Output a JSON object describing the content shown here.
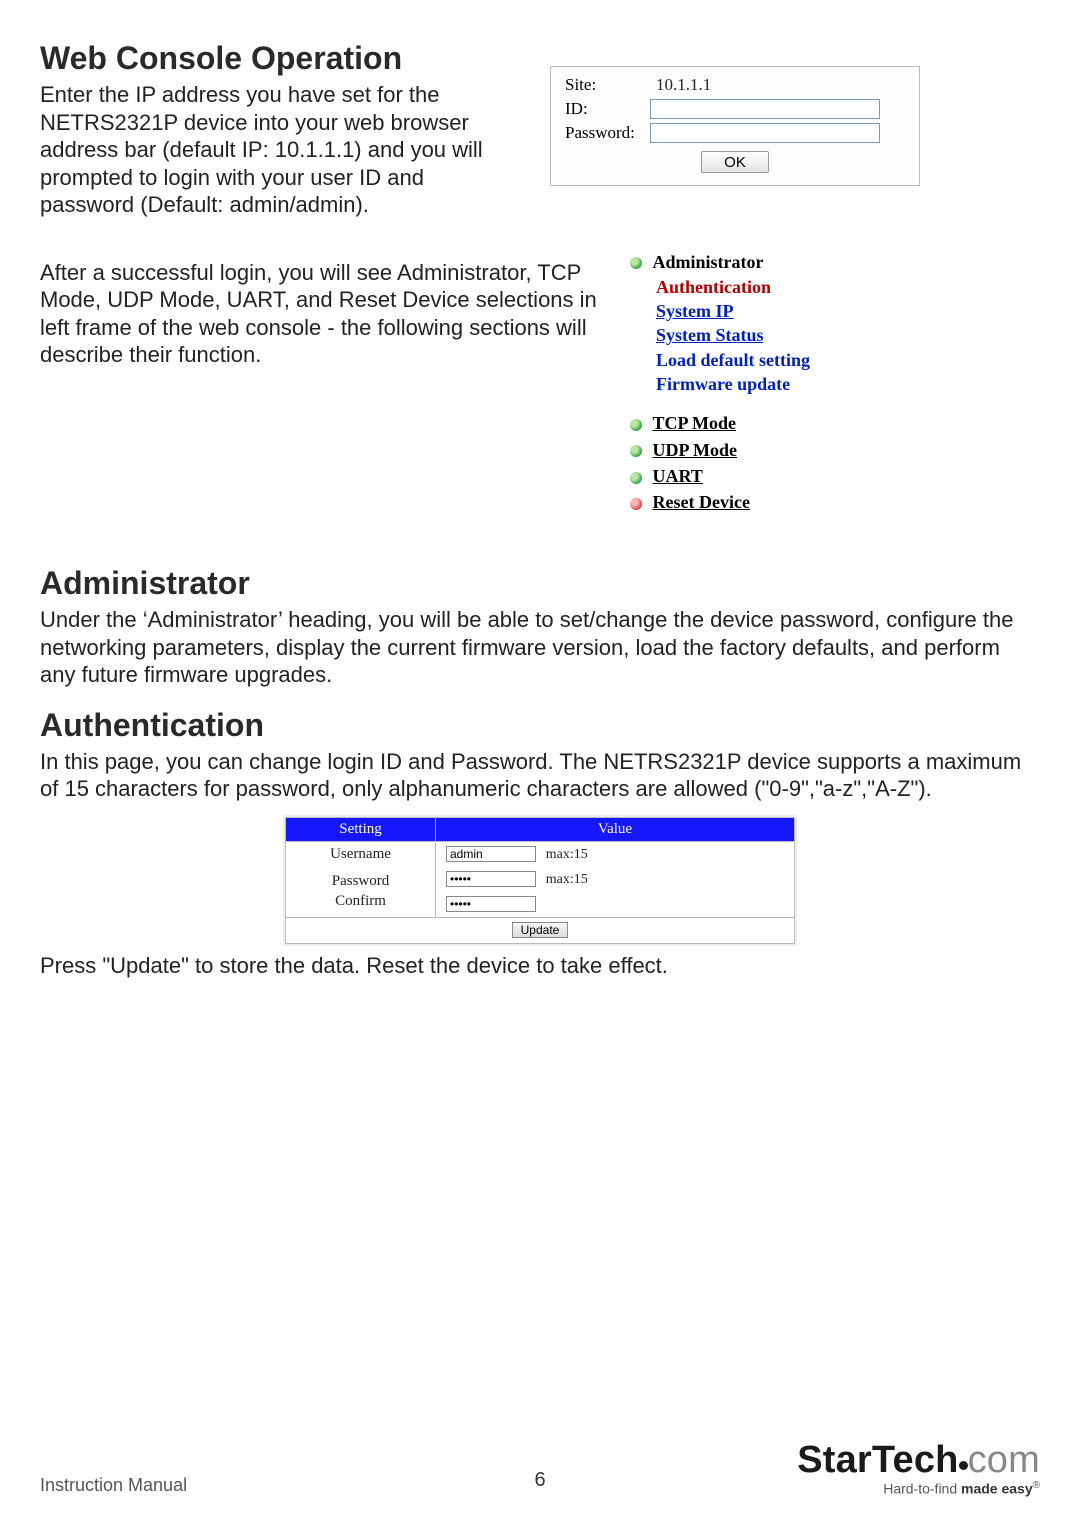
{
  "section1": {
    "heading": "Web Console Operation",
    "para1": "Enter the IP address you have set for the NETRS2321P device into your web browser address bar (default IP: 10.1.1.1) and you will prompted to login with your user ID and password (Default: admin/admin).",
    "para2": "After a successful login, you will see Administrator, TCP Mode, UDP Mode, UART, and Reset Device selections in left frame of the web console - the following sections will describe their function."
  },
  "login": {
    "site_label": "Site:",
    "site_value": "10.1.1.1",
    "id_label": "ID:",
    "id_value": "",
    "pw_label": "Password:",
    "pw_value": "",
    "ok": "OK"
  },
  "nav": {
    "admin": "Administrator",
    "subs": {
      "auth": "Authentication",
      "sysip": "System IP",
      "sysstat": "System Status",
      "load": "Load default setting",
      "fw": "Firmware update"
    },
    "tcp": "TCP Mode",
    "udp": "UDP Mode",
    "uart": "UART",
    "reset": "Reset Device"
  },
  "admin_section": {
    "heading": "Administrator",
    "para": "Under the ‘Administrator’ heading, you will be able to set/change the device password, configure the networking parameters, display the current firmware version, load the factory defaults, and perform any future firmware upgrades."
  },
  "auth_section": {
    "heading": "Authentication",
    "para": "In this page, you can change login ID and Password. The NETRS2321P device supports a maximum of 15 characters for password, only alphanumeric characters are allowed (\"0-9\",\"a-z\",\"A-Z\").",
    "after": "Press \"Update\" to store the data. Reset the device to take effect."
  },
  "auth_table": {
    "col_setting": "Setting",
    "col_value": "Value",
    "username_label": "Username",
    "username_value": "admin",
    "max_hint": "max:15",
    "password_label": "Password",
    "confirm_label": "Confirm",
    "password_value": "•••••",
    "confirm_value": "•••••",
    "update": "Update"
  },
  "footer": {
    "manual": "Instruction Manual",
    "page": "6",
    "brand1": "StarTech",
    "brand_dot": ".",
    "brand2": "com",
    "tag1": "Hard-to-find ",
    "tag2": "made easy",
    "reg": "®"
  }
}
